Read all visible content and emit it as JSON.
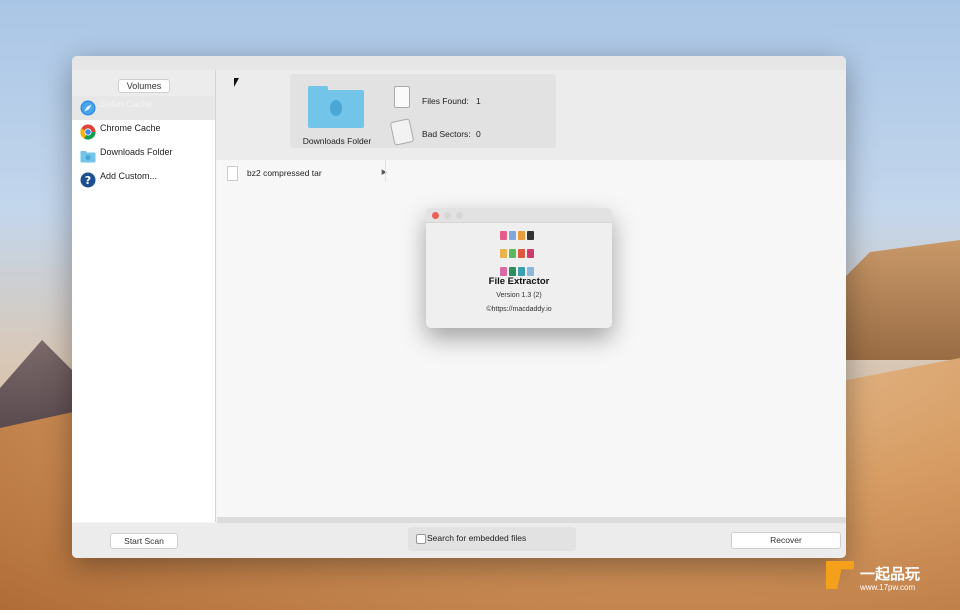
{
  "sidebar": {
    "header": "Volumes",
    "items": [
      {
        "label": "Safari Cache",
        "sub": "",
        "icon": "safari-icon",
        "selected": true
      },
      {
        "label": "Chrome Cache",
        "sub": "",
        "icon": "chrome-icon"
      },
      {
        "label": "Downloads Folder",
        "sub": "",
        "icon": "folder-icon"
      },
      {
        "label": "Add Custom...",
        "sub": "",
        "icon": "question-icon"
      }
    ]
  },
  "toolbar": {
    "selected_volume": "Downloads Folder",
    "files_found_label": "Files Found:",
    "files_found_value": "1",
    "bad_sectors_label": "Bad Sectors:",
    "bad_sectors_value": "0"
  },
  "content": {
    "rows": [
      {
        "label": "bz2 compressed tar"
      }
    ]
  },
  "bottom": {
    "start_scan": "Start Scan",
    "embedded_label": "Search for embedded files",
    "recover": "Recover"
  },
  "about": {
    "app_name": "File Extractor",
    "version": "Version 1.3 (2)",
    "url": "©https://macdaddy.io"
  },
  "watermark": {
    "text": "一起品玩",
    "url": "www.17pw.com"
  },
  "colors": {
    "folder": "#72c4e8",
    "close": "#ee5f57",
    "accent": "#f5a01a"
  }
}
